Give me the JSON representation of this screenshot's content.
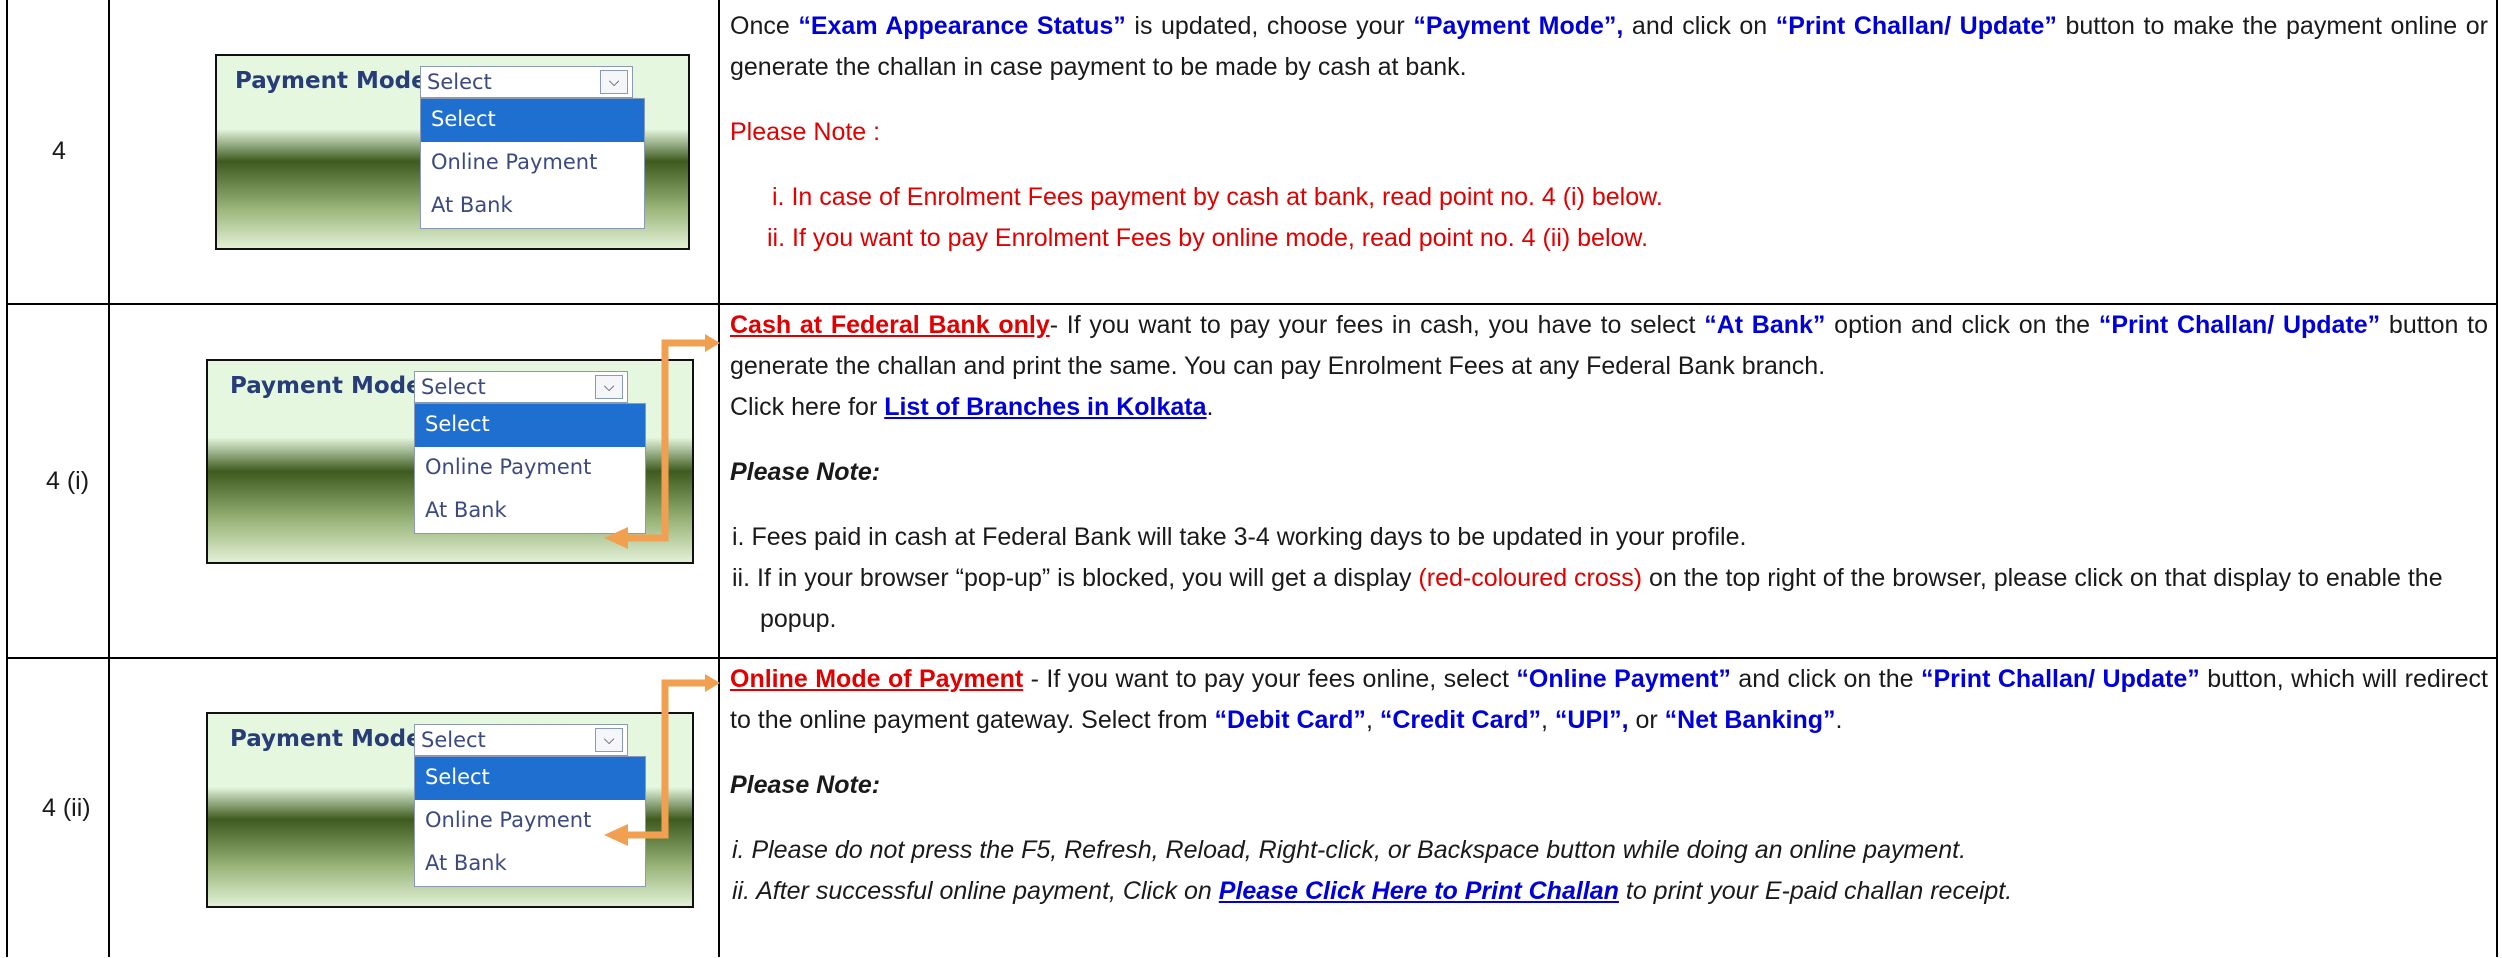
{
  "widget": {
    "label": "Payment Mode:",
    "selected": "Select",
    "options": [
      "Select",
      "Online Payment",
      "At Bank"
    ]
  },
  "rows": [
    {
      "num": "4",
      "p1_a": "Once ",
      "p1_b": "“Exam Appearance Status”",
      "p1_c": " is updated, choose your ",
      "p1_d": "“Payment Mode”,",
      "p1_e": " and click on ",
      "p1_f": "“Print Challan/ Update”",
      "p1_g": " button to make the payment online or generate the challan in case payment to be made by cash at bank.",
      "note": "Please Note :",
      "items": [
        "i.  In case of Enrolment Fees payment by cash at bank, read point no. 4 (i) below.",
        "ii.  If you want to pay Enrolment Fees by online mode, read point no. 4 (ii) below."
      ]
    },
    {
      "num": "4 (i)",
      "p1_a": "Cash at Federal Bank only",
      "p1_b": "- If you want to pay your fees in cash, you have to select ",
      "p1_c": "“At Bank”",
      "p1_d": " option and click on the ",
      "p1_e": "“Print Challan/ Update”",
      "p1_f": " button to generate the challan and print the same. You can pay Enrolment Fees at any Federal Bank branch.",
      "p2_a": "Click here for ",
      "p2_b": "List of Branches in Kolkata",
      "p2_c": ".",
      "note": "Please Note:",
      "item1": "i.  Fees paid in cash at Federal Bank will take 3-4 working days to be updated in your profile.",
      "item2_a": "ii.  If in your browser “pop-up” is blocked, you will get a display ",
      "item2_b": "(red-coloured cross)",
      "item2_c": " on the top right of the browser, please click on that display to enable the popup."
    },
    {
      "num": "4 (ii)",
      "p1_a": "Online Mode of Payment",
      "p1_b": " - If you want to pay your fees online, select ",
      "p1_c": "“Online Payment”",
      "p1_d": " and click on the ",
      "p1_e": "“Print Challan/ Update”",
      "p1_f": " button, which will redirect to the online payment gateway. Select from ",
      "p1_g": "“Debit Card”",
      "p1_h": ", ",
      "p1_i": "“Credit Card”",
      "p1_j": ", ",
      "p1_k": "“UPI”,",
      "p1_l": " or ",
      "p1_m": "“Net Banking”",
      "p1_n": ".",
      "note": "Please Note:",
      "item1": "i.  Please do not press the F5, Refresh, Reload, Right-click, or Backspace button while doing an online payment.",
      "item2_a": "ii.  After successful online payment, Click on ",
      "item2_b": "Please Click Here to Print Challan",
      "item2_c": " to print your E-paid challan receipt."
    }
  ],
  "colors": {
    "accent_blue": "#0000d8",
    "note_red": "#e10000",
    "arrow_orange": "#f0a050",
    "dropdown_highlight": "#1f6fd0"
  }
}
